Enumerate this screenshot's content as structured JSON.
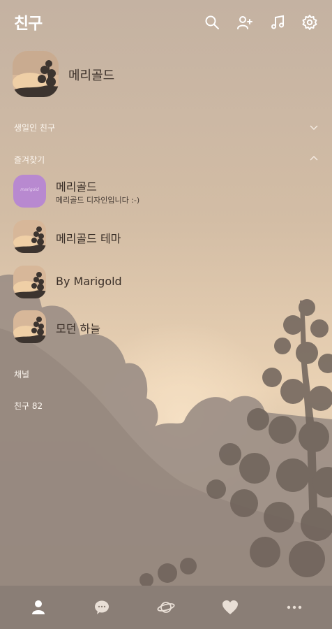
{
  "header": {
    "title": "친구",
    "icons": [
      "search-icon",
      "add-friend-icon",
      "music-icon",
      "settings-icon"
    ]
  },
  "my_profile": {
    "name": "메리골드"
  },
  "sections": {
    "birthday": "생일인 친구",
    "favorites": "즐겨찾기",
    "channel": "채널",
    "friends": "친구 82"
  },
  "favorites": [
    {
      "name": "메리골드",
      "status": "메리골드 디자인입니다 :-)",
      "avatar_text": "marigold"
    },
    {
      "name": "메리골드 테마",
      "status": ""
    },
    {
      "name": "By Marigold",
      "status": ""
    },
    {
      "name": "모던 하늘",
      "status": ""
    }
  ],
  "bottom_nav": [
    "person-icon",
    "chat-icon",
    "planet-icon",
    "heart-icon",
    "more-icon"
  ],
  "colors": {
    "bottom_bar": "#8a7e76",
    "text_dark": "#3a2f28",
    "purple_avatar": "#b889d0"
  }
}
